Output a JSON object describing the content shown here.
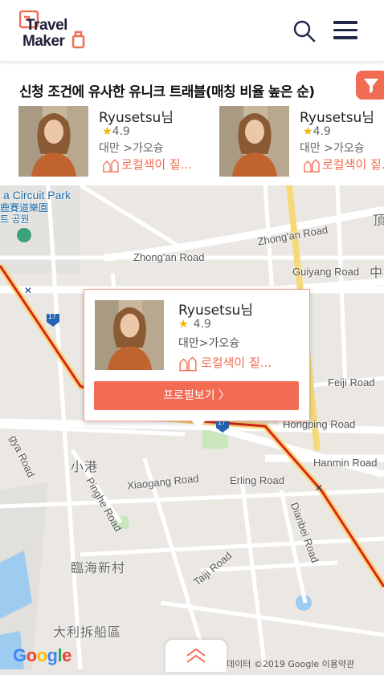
{
  "header": {
    "logo_line1": "Travel",
    "logo_line2": "Maker",
    "search_icon": "search-icon",
    "menu_icon": "hamburger-menu-icon"
  },
  "recommendations": {
    "title": "신청 조건에 유사한 유니크 트래블(매칭 비율 높은 순)",
    "filter_icon": "filter-icon",
    "cards": [
      {
        "name": "Ryusetsu님",
        "star": "★",
        "rating": "4.9",
        "location": "대만 >가오슝",
        "tag": "로컬색이 짙..."
      },
      {
        "name": "Ryusetsu님",
        "star": "★",
        "rating": "4.9",
        "location": "대만 >가오슝",
        "tag": "로컬색이 짙..."
      }
    ]
  },
  "map": {
    "labels": {
      "circuit_park": "a Circuit Park",
      "circuit_cn1": "鹿賽道樂園",
      "circuit_kr": "트 공원",
      "zhongan_road1": "Zhong'an Road",
      "zhongan_road2": "Zhong'an Road",
      "guiyang_road": "Guiyang Road",
      "feiji_road": "Feiji Road",
      "hongping_road": "Hongping Road",
      "hanmin_road": "Hanmin Road",
      "xiaogang_road": "Xiaogang Road",
      "erling_road": "Erling Road",
      "pinghe_road": "Pinghe Road",
      "dianbei_road": "Dianbei Road",
      "taiji_road": "Taiji Road",
      "xiaogang_cn": "小港",
      "linhai_cn": "臨海新村",
      "dali_cn": "大利拆船區",
      "gangya_road": "gya Road",
      "ding_cn": "頂",
      "zhong_cn": "中",
      "highway": "17",
      "highway2": "17"
    },
    "google": {
      "g1": "G",
      "o1": "o",
      "o2": "o",
      "g2": "g",
      "l": "l",
      "e": "e"
    },
    "attribution": "데이터 ©2019 Google   이용약관"
  },
  "popup": {
    "name": "Ryusetsu님",
    "star": "★",
    "rating": "4.9",
    "location": "대만>가오슝",
    "tag": "로컬색이 짙...",
    "profile_button": "프로필보기 〉"
  },
  "colors": {
    "accent": "#f26c54",
    "navy": "#1f2a4a",
    "star": "#f5b400"
  }
}
